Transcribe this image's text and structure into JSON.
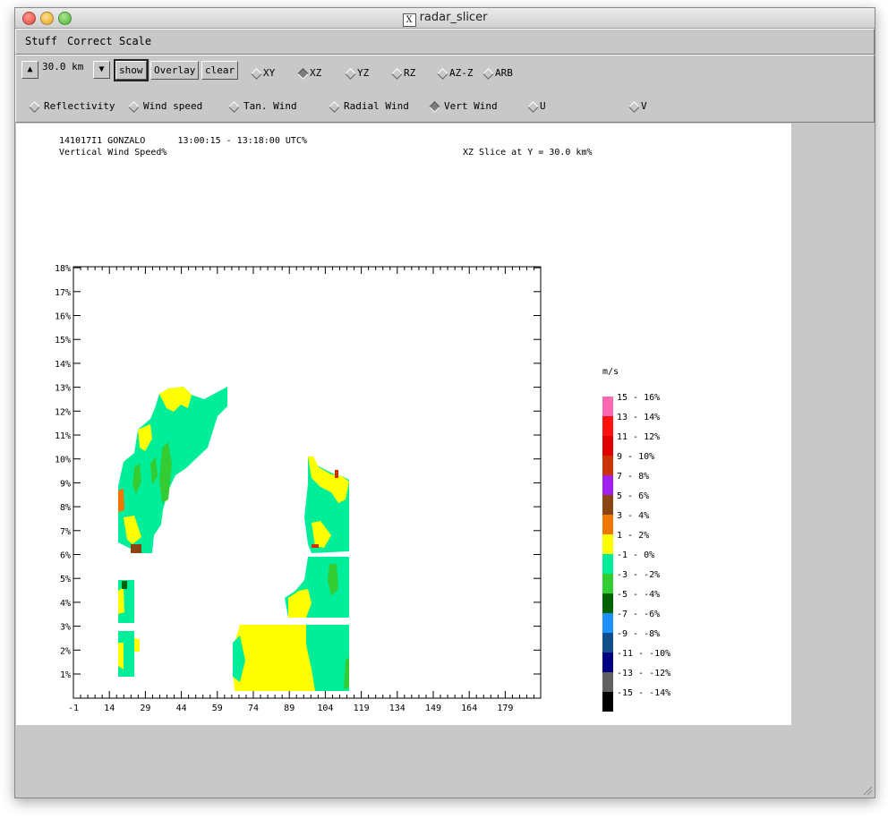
{
  "window": {
    "title": "radar_slicer"
  },
  "menu": [
    "Stuff",
    "Correct",
    "Scale"
  ],
  "toolbar": {
    "height_value": "30.0 km",
    "show_label": "show",
    "overlay_label": "Overlay",
    "clear_label": "clear",
    "slice_modes": [
      {
        "label": "XY",
        "selected": false
      },
      {
        "label": "XZ",
        "selected": true
      },
      {
        "label": "YZ",
        "selected": false
      },
      {
        "label": "RZ",
        "selected": false
      },
      {
        "label": "AZ-Z",
        "selected": false
      },
      {
        "label": "ARB",
        "selected": false
      }
    ],
    "fields": [
      {
        "label": "Reflectivity",
        "selected": false
      },
      {
        "label": "Wind speed",
        "selected": false
      },
      {
        "label": "Tan. Wind",
        "selected": false
      },
      {
        "label": "Radial Wind",
        "selected": false
      },
      {
        "label": "Vert Wind",
        "selected": true
      },
      {
        "label": "U",
        "selected": false
      },
      {
        "label": "V",
        "selected": false
      }
    ]
  },
  "plot": {
    "header_line1": "141017I1 GONZALO      13:00:15 - 13:18:00 UTC%",
    "header_line2": "Vertical Wind Speed%",
    "slice_info": "XZ Slice at Y = 30.0 km%",
    "x_ticks": [
      "-1",
      "14",
      "29",
      "44",
      "59",
      "74",
      "89",
      "104",
      "119",
      "134",
      "149",
      "164",
      "179"
    ],
    "y_ticks": [
      "1%",
      "2%",
      "3%",
      "4%",
      "5%",
      "6%",
      "7%",
      "8%",
      "9%",
      "10%",
      "11%",
      "12%",
      "13%",
      "14%",
      "15%",
      "16%",
      "17%",
      "18%"
    ],
    "legend_title": "m/s",
    "legend": [
      {
        "label": "15 - 16%",
        "color": "#ff69b4"
      },
      {
        "label": "13 - 14%",
        "color": "#ff1010"
      },
      {
        "label": "11 - 12%",
        "color": "#e00000"
      },
      {
        "label": "9 - 10%",
        "color": "#cc3300"
      },
      {
        "label": "7 - 8%",
        "color": "#a020f0"
      },
      {
        "label": "5 - 6%",
        "color": "#8b4513"
      },
      {
        "label": "3 - 4%",
        "color": "#ee7700"
      },
      {
        "label": "1 - 2%",
        "color": "#ffff00"
      },
      {
        "label": "-1 - 0%",
        "color": "#00ee99"
      },
      {
        "label": "-3 - -2%",
        "color": "#33cc33"
      },
      {
        "label": "-5 - -4%",
        "color": "#006400"
      },
      {
        "label": "-7 - -6%",
        "color": "#1e90ff"
      },
      {
        "label": "-9 - -8%",
        "color": "#104e8b"
      },
      {
        "label": "-11 - -10%",
        "color": "#000080"
      },
      {
        "label": "-13 - -12%",
        "color": "#606060"
      },
      {
        "label": "-15 - -14%",
        "color": "#000000"
      }
    ]
  }
}
